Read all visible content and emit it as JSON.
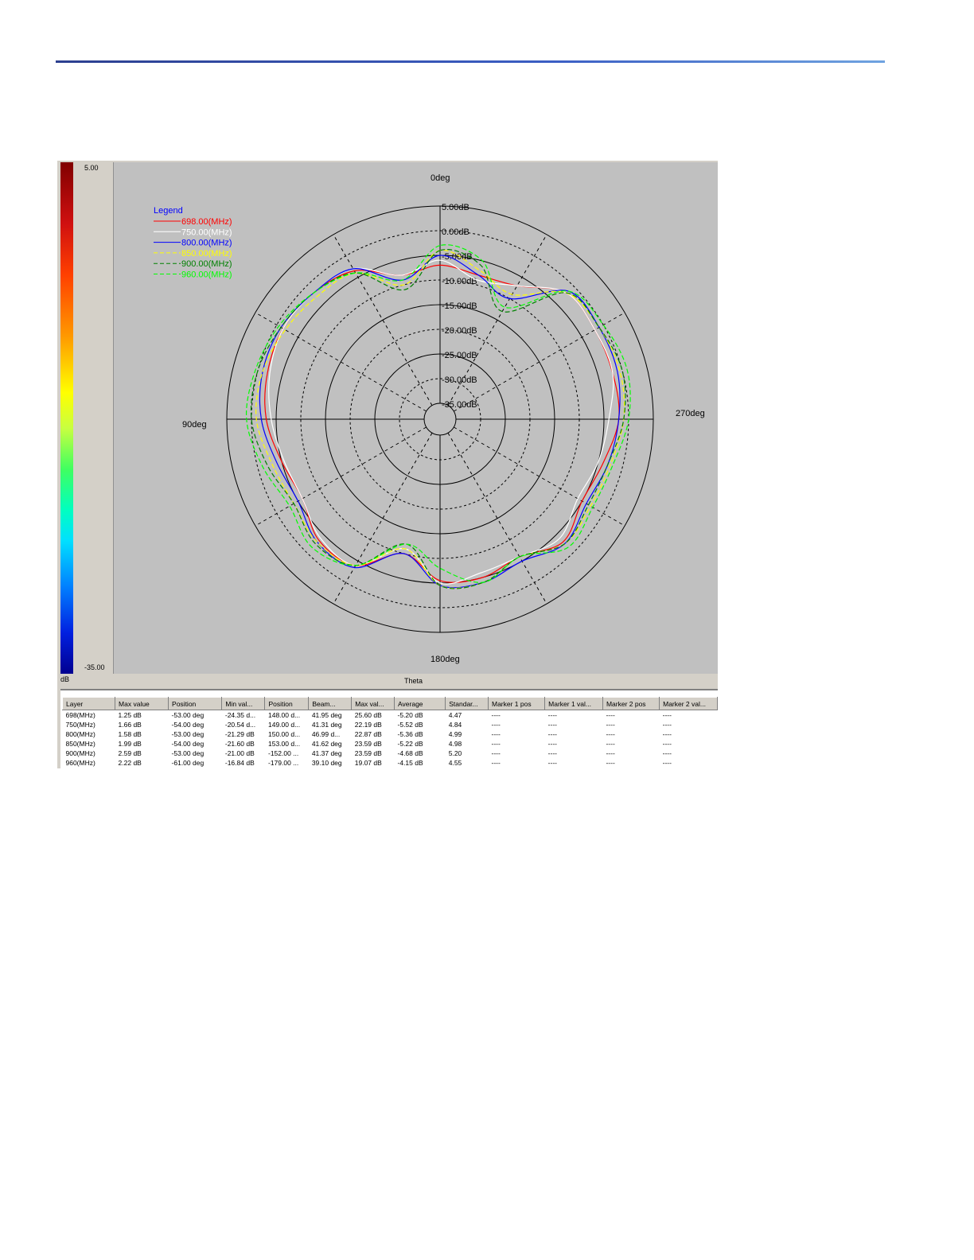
{
  "color_scale": {
    "max_label": "5.00",
    "min_label": "-35.00",
    "unit": "dB"
  },
  "chart_data": {
    "type": "polar",
    "angle_labels": {
      "top": "0deg",
      "left": "90deg",
      "right": "270deg",
      "bottom": "180deg"
    },
    "radial_ticks": [
      "5.00dB",
      "0.00dB",
      "-5.00dB",
      "-10.00dB",
      "-15.00dB",
      "-20.00dB",
      "-25.00dB",
      "-30.00dB",
      "-35.00dB"
    ],
    "radial_range": [
      -35,
      5
    ],
    "angular_axis_label": "Theta",
    "legend_title": "Legend",
    "angles_deg": [
      0,
      15,
      30,
      45,
      60,
      75,
      90,
      105,
      120,
      135,
      150,
      165,
      180,
      195,
      210,
      225,
      240,
      255,
      270,
      285,
      300,
      315,
      330,
      345
    ],
    "series": [
      {
        "name": "698.00(MHz)",
        "color": "#ff0000",
        "dashed": false,
        "values": [
          -7,
          -8,
          -3.5,
          -2,
          -1.5,
          -2,
          -3,
          -5,
          -6,
          -3.5,
          -4,
          -10,
          -5.5,
          -5,
          -6,
          -3,
          -5,
          -4,
          -2,
          -2,
          -2,
          -2,
          -7,
          -8
        ]
      },
      {
        "name": "750.00(MHz)",
        "color": "#ffffff",
        "dashed": false,
        "values": [
          -6,
          -8,
          -3,
          -2,
          -1.5,
          -2.5,
          -4,
          -5.5,
          -6,
          -4,
          -4,
          -11,
          -5,
          -6,
          -6,
          -4,
          -6,
          -5,
          -4,
          -2,
          -2,
          -2,
          -7,
          -9
        ]
      },
      {
        "name": "800.00(MHz)",
        "color": "#0000ff",
        "dashed": false,
        "values": [
          -5,
          -9,
          -3,
          -2,
          -1,
          -1,
          -2,
          -4,
          -5,
          -3,
          -3.5,
          -10,
          -4.5,
          -4,
          -5,
          -2.5,
          -4,
          -3,
          -2,
          -1,
          -1,
          -1.5,
          -10,
          -8
        ]
      },
      {
        "name": "850.00(MHz)",
        "color": "#ffff00",
        "dashed": true,
        "values": [
          -4,
          -10,
          -4,
          -3,
          -2,
          -1,
          -1,
          -3,
          -4,
          -3,
          -4,
          -11,
          -4.5,
          -4,
          -6,
          -2.5,
          -3,
          -2.5,
          -1,
          -0.5,
          -1,
          -2,
          -9,
          -7
        ]
      },
      {
        "name": "900.00(MHz)",
        "color": "#008000",
        "dashed": true,
        "values": [
          -4,
          -11,
          -4,
          -2,
          -1,
          0,
          0,
          -2,
          -4,
          -2.5,
          -4,
          -12,
          -4.5,
          -4,
          -6,
          -2.5,
          -3.5,
          -3,
          -1,
          0,
          -1,
          -2,
          -13,
          -6
        ]
      },
      {
        "name": "960.00(MHz)",
        "color": "#00ff00",
        "dashed": true,
        "values": [
          -3,
          -9,
          -4,
          -2,
          -0.5,
          0.5,
          1,
          -1,
          -3,
          -1.5,
          -4,
          -12,
          -8,
          -4,
          -6,
          -1.5,
          -2.5,
          -2,
          0,
          1,
          0,
          -1.5,
          -12,
          -5
        ]
      }
    ]
  },
  "table": {
    "headers": [
      "Layer",
      "Max value",
      "Position",
      "Min val...",
      "Position",
      "Beam...",
      "Max val...",
      "Average",
      "Standar...",
      "Marker 1 pos",
      "Marker 1 val...",
      "Marker 2 pos",
      "Marker 2 val..."
    ],
    "rows": [
      [
        "698(MHz)",
        "1.25 dB",
        "-53.00 deg",
        "-24.35 d...",
        "148.00 d...",
        "41.95 deg",
        "25.60 dB",
        "-5.20 dB",
        "4.47",
        "----",
        "----",
        "----",
        "----"
      ],
      [
        "750(MHz)",
        "1.66 dB",
        "-54.00 deg",
        "-20.54 d...",
        "149.00 d...",
        "41.31 deg",
        "22.19 dB",
        "-5.52 dB",
        "4.84",
        "----",
        "----",
        "----",
        "----"
      ],
      [
        "800(MHz)",
        "1.58 dB",
        "-53.00 deg",
        "-21.29 dB",
        "150.00 d...",
        "46.99 d...",
        "22.87 dB",
        "-5.36 dB",
        "4.99",
        "----",
        "----",
        "----",
        "----"
      ],
      [
        "850(MHz)",
        "1.99 dB",
        "-54.00 deg",
        "-21.60 dB",
        "153.00 d...",
        "41.62 deg",
        "23.59 dB",
        "-5.22 dB",
        "4.98",
        "----",
        "----",
        "----",
        "----"
      ],
      [
        "900(MHz)",
        "2.59 dB",
        "-53.00 deg",
        "-21.00 dB",
        "-152.00 ...",
        "41.37 deg",
        "23.59 dB",
        "-4.68 dB",
        "5.20",
        "----",
        "----",
        "----",
        "----"
      ],
      [
        "960(MHz)",
        "2.22 dB",
        "-61.00 deg",
        "-16.84 dB",
        "-179.00 ...",
        "39.10 deg",
        "19.07 dB",
        "-4.15 dB",
        "4.55",
        "----",
        "----",
        "----",
        "----"
      ]
    ]
  }
}
